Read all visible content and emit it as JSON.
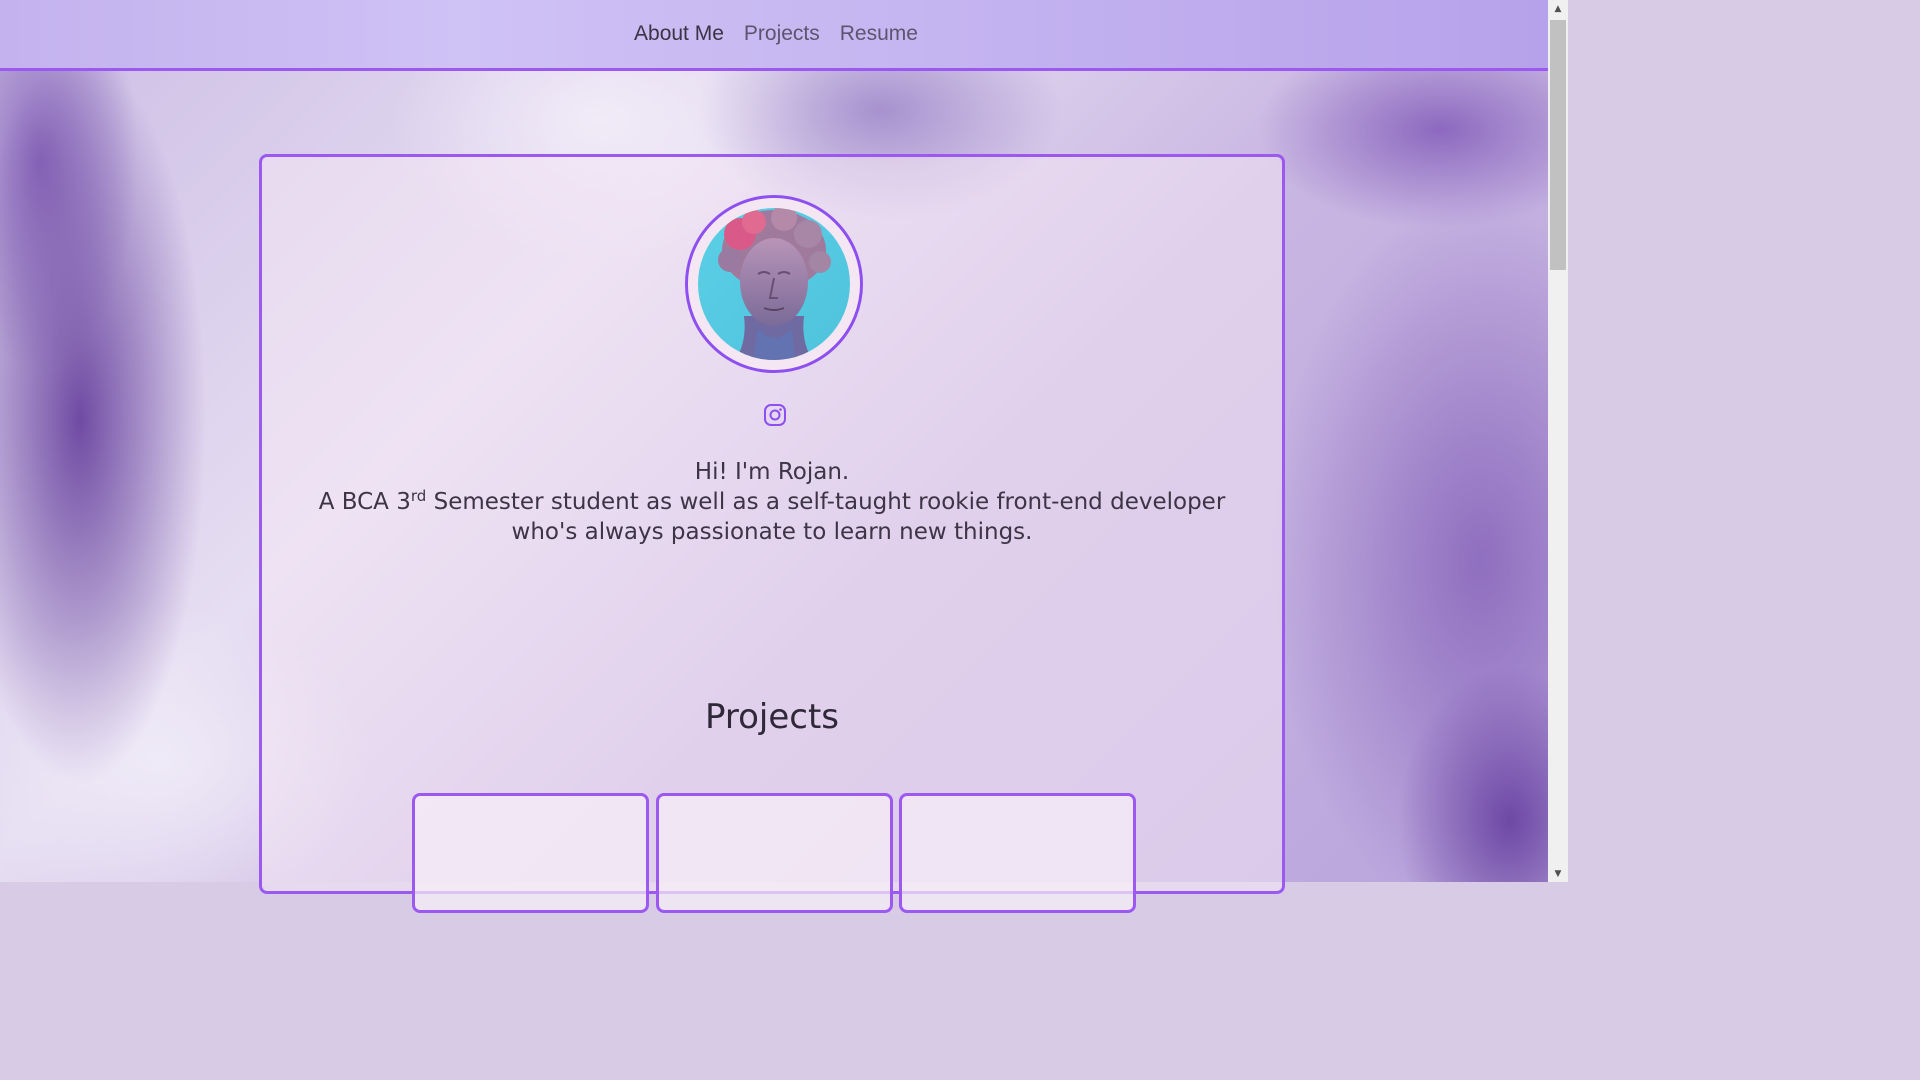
{
  "nav": {
    "links": [
      {
        "label": "About Me",
        "active": true
      },
      {
        "label": "Projects",
        "active": false
      },
      {
        "label": "Resume",
        "active": false
      }
    ]
  },
  "profile": {
    "avatar_icon": "statue-bust-avatar",
    "social_icon": "instagram-icon",
    "greeting": "Hi! I'm Rojan.",
    "bio_prefix": "A BCA 3",
    "bio_sup": "rd",
    "bio_line1_rest": " Semester student as well as a self-taught rookie front-end developer",
    "bio_line2": "who's always passionate to learn new things."
  },
  "projects": {
    "title": "Projects",
    "cards": [
      {},
      {},
      {}
    ]
  },
  "colors": {
    "accent": "#9b59ef",
    "nav_bg": "#c8b9f2",
    "text": "#3d3446"
  },
  "scrollbar": {
    "up": "▲",
    "down": "▼"
  }
}
